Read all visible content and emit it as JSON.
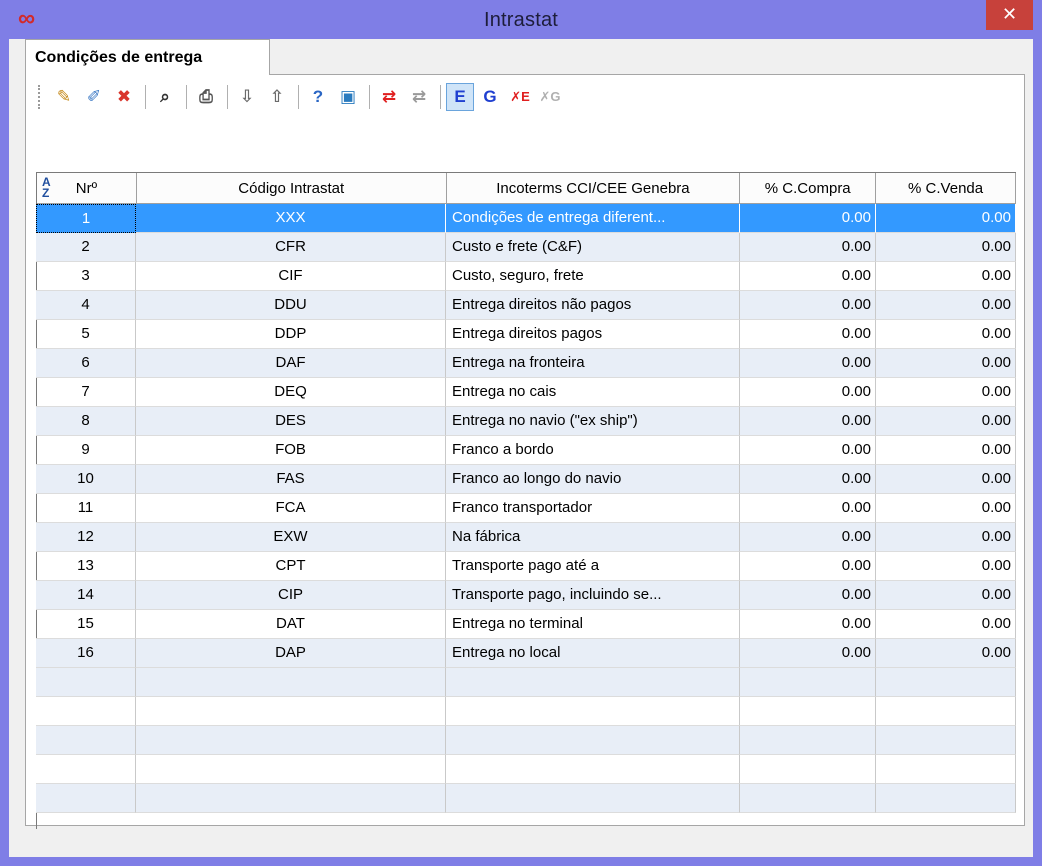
{
  "window": {
    "title": "Intrastat",
    "close_glyph": "✕",
    "app_icon": "∞"
  },
  "tab": {
    "label": "Condições de entrega"
  },
  "toolbar": {
    "buttons": [
      {
        "name": "new-record-icon",
        "glyph": "✎",
        "color": "#c58a1c"
      },
      {
        "name": "edit-record-icon",
        "glyph": "✐",
        "color": "#3a78c4"
      },
      {
        "name": "delete-record-icon",
        "glyph": "✖",
        "color": "#d9342b"
      },
      {
        "name": "search-binoculars-icon",
        "glyph": "⌕",
        "color": "#333333"
      },
      {
        "name": "print-icon",
        "glyph": "⎙",
        "color": "#555555"
      },
      {
        "name": "import-icon",
        "glyph": "⇩",
        "color": "#6b6b6b"
      },
      {
        "name": "export-icon",
        "glyph": "⇧",
        "color": "#6b6b6b"
      },
      {
        "name": "help-icon",
        "glyph": "?",
        "color": "#2a66c4"
      },
      {
        "name": "exit-icon",
        "glyph": "▣",
        "color": "#2a7bbf"
      },
      {
        "name": "swap-red-icon",
        "glyph": "⇄",
        "color": "#e02020"
      },
      {
        "name": "swap-gray-icon",
        "glyph": "⇄",
        "color": "#9a9a9a"
      },
      {
        "name": "letter-e-icon",
        "glyph": "E",
        "color": "#1f3fd0"
      },
      {
        "name": "letter-g-icon",
        "glyph": "G",
        "color": "#1f3fd0"
      },
      {
        "name": "remove-e-icon",
        "glyph": "✗E",
        "color": "#e02020"
      },
      {
        "name": "remove-g-icon",
        "glyph": "✗G",
        "color": "#b0b0b0"
      }
    ]
  },
  "table": {
    "headers": [
      "Nrº",
      "Código Intrastat",
      "Incoterms CCI/CEE Genebra",
      "% C.Compra",
      "% C.Venda"
    ],
    "rows": [
      [
        "1",
        "XXX",
        "Condições de entrega diferent...",
        "0.00",
        "0.00"
      ],
      [
        "2",
        "CFR",
        "Custo e frete (C&F)",
        "0.00",
        "0.00"
      ],
      [
        "3",
        "CIF",
        "Custo, seguro, frete",
        "0.00",
        "0.00"
      ],
      [
        "4",
        "DDU",
        "Entrega direitos não pagos",
        "0.00",
        "0.00"
      ],
      [
        "5",
        "DDP",
        "Entrega direitos pagos",
        "0.00",
        "0.00"
      ],
      [
        "6",
        "DAF",
        "Entrega na fronteira",
        "0.00",
        "0.00"
      ],
      [
        "7",
        "DEQ",
        "Entrega no cais",
        "0.00",
        "0.00"
      ],
      [
        "8",
        "DES",
        "Entrega no navio (\"ex ship\")",
        "0.00",
        "0.00"
      ],
      [
        "9",
        "FOB",
        "Franco a bordo",
        "0.00",
        "0.00"
      ],
      [
        "10",
        "FAS",
        "Franco ao longo do navio",
        "0.00",
        "0.00"
      ],
      [
        "11",
        "FCA",
        "Franco transportador",
        "0.00",
        "0.00"
      ],
      [
        "12",
        "EXW",
        "Na fábrica",
        "0.00",
        "0.00"
      ],
      [
        "13",
        "CPT",
        "Transporte pago até a",
        "0.00",
        "0.00"
      ],
      [
        "14",
        "CIP",
        "Transporte pago, incluindo se...",
        "0.00",
        "0.00"
      ],
      [
        "15",
        "DAT",
        "Entrega no terminal",
        "0.00",
        "0.00"
      ],
      [
        "16",
        "DAP",
        "Entrega no local",
        "0.00",
        "0.00"
      ]
    ],
    "selected_row": 0,
    "empty_rows": 5
  },
  "colors": {
    "title_bar": "#7f7ee6",
    "selection": "#3399ff",
    "alt_row": "#e8eef7",
    "close_button": "#c7413b"
  }
}
